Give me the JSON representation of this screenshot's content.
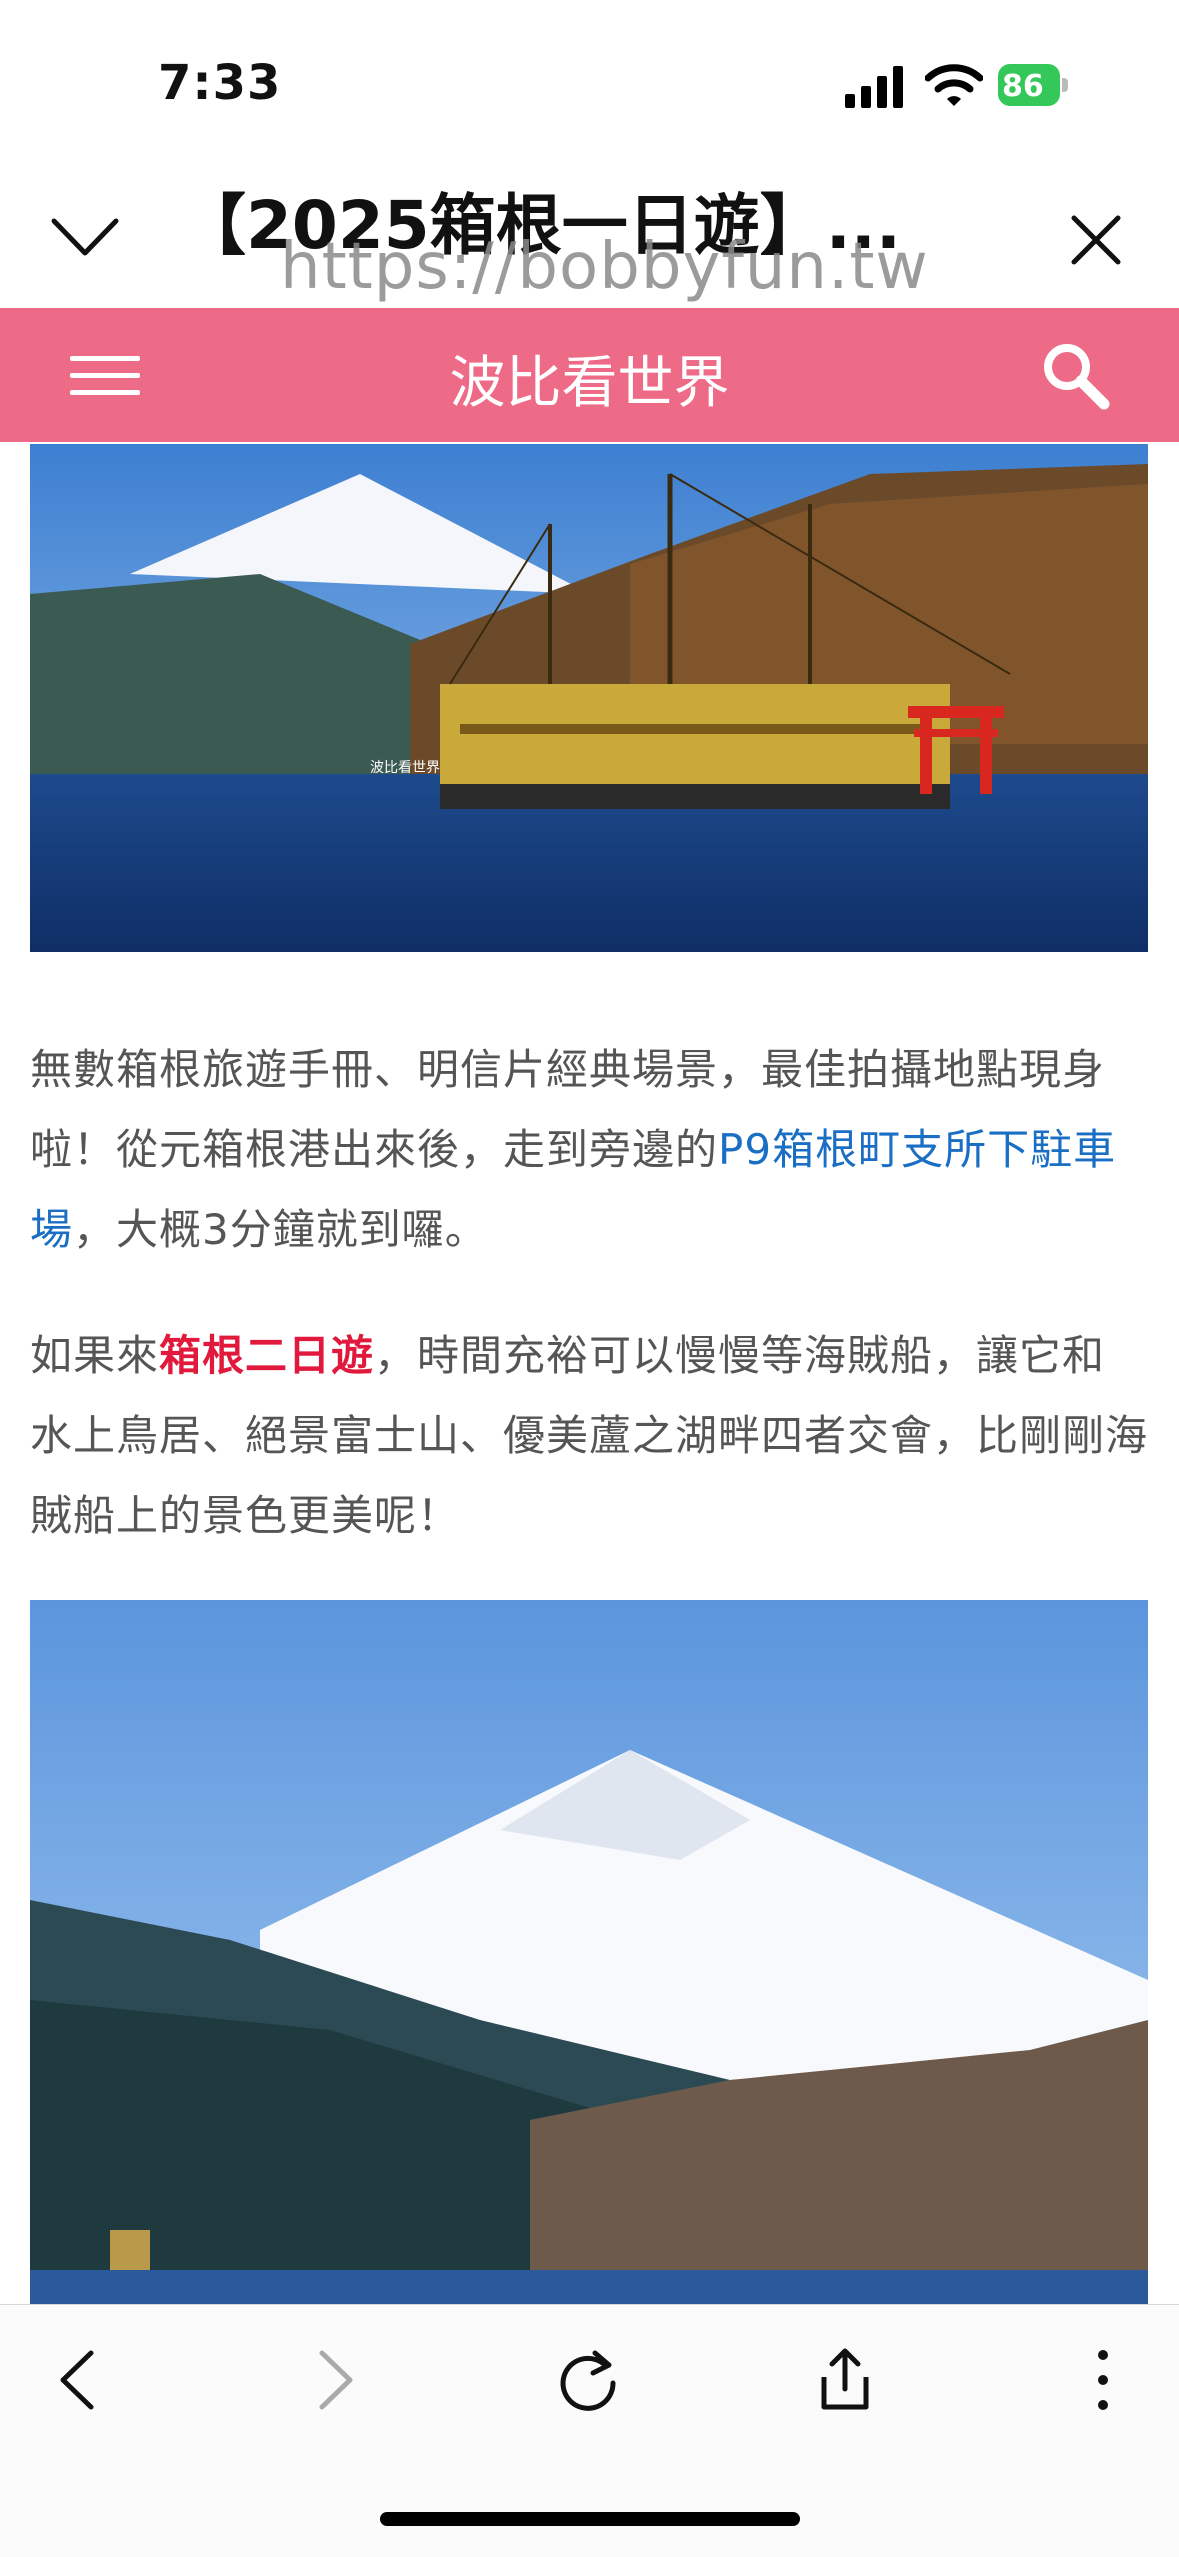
{
  "status": {
    "time": "7:33",
    "battery": "86",
    "icons": [
      "signal-icon",
      "wifi-icon",
      "battery-icon"
    ]
  },
  "titlebar": {
    "title": "【2025箱根一日遊】...",
    "url": "https://bobbyfun.tw"
  },
  "site": {
    "name": "波比看世界",
    "accent": "#ee6b87"
  },
  "content": {
    "p1": {
      "text1": "無數箱根旅遊手冊、明信片經典場景，最佳拍攝地點現身啦！從元箱根港出來後，走到旁邊的",
      "link": "P9箱根町支所下駐車場",
      "text2": "，大概3分鐘就到囉。"
    },
    "p2": {
      "text1": "如果來",
      "highlight": "箱根二日遊",
      "text2": "，時間充裕可以慢慢等海賊船，讓它和水上鳥居、絕景富士山、優美蘆之湖畔四者交會，比剛剛海賊船上的景色更美呢！"
    },
    "watermark": "波比看世界"
  },
  "colors": {
    "link": "#1a6fc4",
    "highlight": "#e0193d",
    "battery": "#34c759"
  }
}
